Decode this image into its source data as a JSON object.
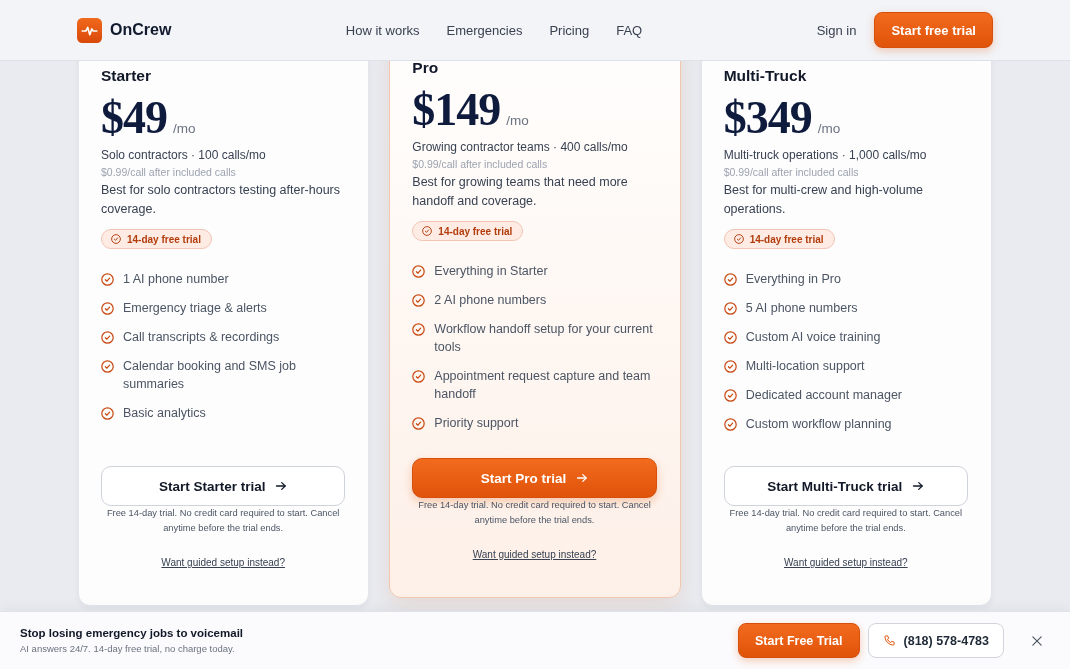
{
  "header": {
    "brand": "OnCrew",
    "nav": [
      "How it works",
      "Emergencies",
      "Pricing",
      "FAQ"
    ],
    "sign_in": "Sign in",
    "cta": "Start free trial"
  },
  "plans": [
    {
      "name": "Starter",
      "featured": false,
      "price": "$49",
      "period": "/mo",
      "audience": "Solo contractors · 100 calls/mo",
      "overage": "$0.99/call after included calls",
      "description": "Best for solo contractors testing after-hours coverage.",
      "badge": "14-day free trial",
      "features": [
        "1 AI phone number",
        "Emergency triage & alerts",
        "Call transcripts & recordings",
        "Calendar booking and SMS job summaries",
        "Basic analytics"
      ],
      "cta": "Start Starter trial",
      "fine_print": "Free 14-day trial. No credit card required to start. Cancel anytime before the trial ends.",
      "link": "Want guided setup instead?"
    },
    {
      "name": "Pro",
      "featured": true,
      "price": "$149",
      "period": "/mo",
      "audience": "Growing contractor teams · 400 calls/mo",
      "overage": "$0.99/call after included calls",
      "description": "Best for growing teams that need more handoff and coverage.",
      "badge": "14-day free trial",
      "features": [
        "Everything in Starter",
        "2 AI phone numbers",
        "Workflow handoff setup for your current tools",
        "Appointment request capture and team handoff",
        "Priority support"
      ],
      "cta": "Start Pro trial",
      "fine_print": "Free 14-day trial. No credit card required to start. Cancel anytime before the trial ends.",
      "link": "Want guided setup instead?"
    },
    {
      "name": "Multi-Truck",
      "featured": false,
      "price": "$349",
      "period": "/mo",
      "audience": "Multi-truck operations · 1,000 calls/mo",
      "overage": "$0.99/call after included calls",
      "description": "Best for multi-crew and high-volume operations.",
      "badge": "14-day free trial",
      "features": [
        "Everything in Pro",
        "5 AI phone numbers",
        "Custom AI voice training",
        "Multi-location support",
        "Dedicated account manager",
        "Custom workflow planning"
      ],
      "cta": "Start Multi-Truck trial",
      "fine_print": "Free 14-day trial. No credit card required to start. Cancel anytime before the trial ends.",
      "link": "Want guided setup instead?"
    }
  ],
  "sticky_bar": {
    "headline": "Stop losing emergency jobs to voicemail",
    "subtext": "AI answers 24/7. 14-day free trial, no charge today.",
    "cta": "Start Free Trial",
    "phone": "(818) 578-4783"
  }
}
